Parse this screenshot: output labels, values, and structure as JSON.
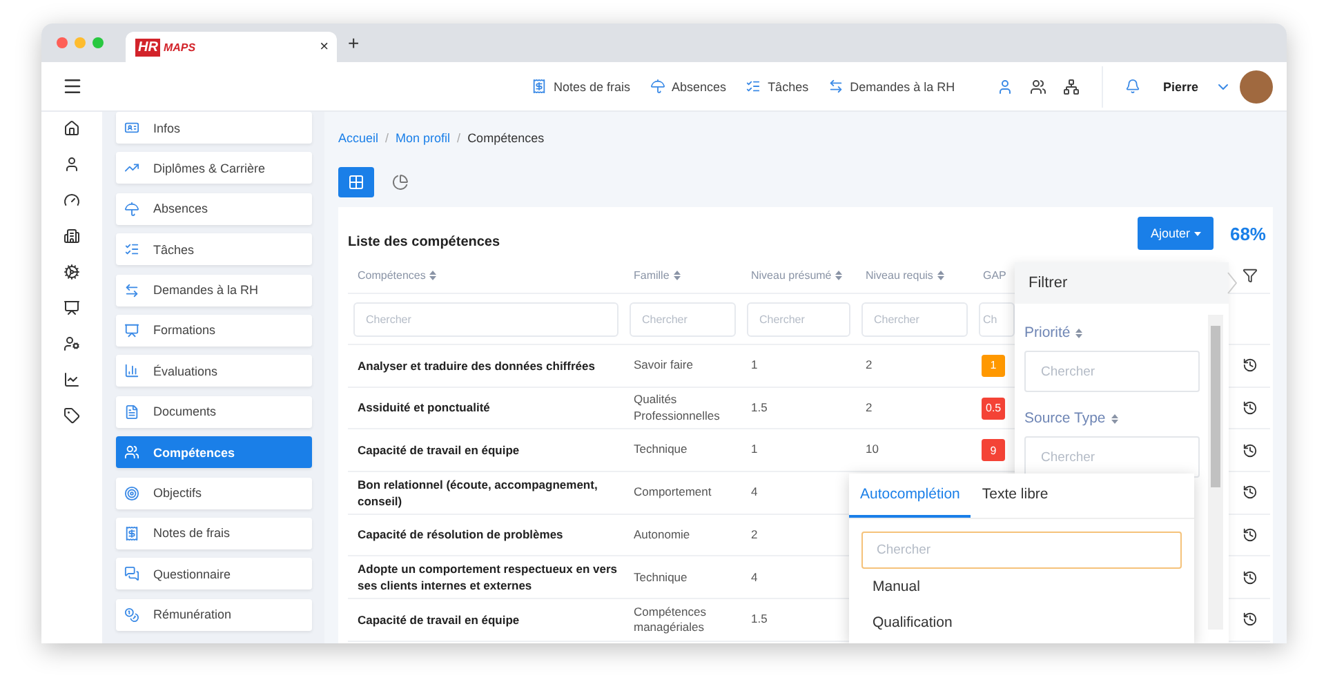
{
  "browser": {
    "tab": {
      "logo_mark": "HR",
      "logo_text": "MAPS",
      "close": "×"
    },
    "new_tab": "+"
  },
  "topbar": {
    "links": [
      {
        "label": "Notes de frais"
      },
      {
        "label": "Absences"
      },
      {
        "label": "Tâches"
      },
      {
        "label": "Demandes à la RH"
      }
    ],
    "user": {
      "name": "Pierre"
    }
  },
  "sidebar": {
    "items": [
      {
        "label": "Infos",
        "selected": false
      },
      {
        "label": "Diplômes & Carrière",
        "selected": false
      },
      {
        "label": "Absences",
        "selected": false
      },
      {
        "label": "Tâches",
        "selected": false
      },
      {
        "label": "Demandes à la RH",
        "selected": false
      },
      {
        "label": "Formations",
        "selected": false
      },
      {
        "label": "Évaluations",
        "selected": false
      },
      {
        "label": "Documents",
        "selected": false
      },
      {
        "label": "Compétences",
        "selected": true
      },
      {
        "label": "Objectifs",
        "selected": false
      },
      {
        "label": "Notes de frais",
        "selected": false
      },
      {
        "label": "Questionnaire",
        "selected": false
      },
      {
        "label": "Rémunération",
        "selected": false
      }
    ]
  },
  "breadcrumb": {
    "separator": "/",
    "items": [
      {
        "label": "Accueil",
        "current": false
      },
      {
        "label": "Mon profil",
        "current": false
      },
      {
        "label": "Compétences",
        "current": true
      }
    ]
  },
  "views": [
    {
      "kind": "table",
      "selected": true
    },
    {
      "kind": "chart",
      "selected": false
    }
  ],
  "card": {
    "title": "Liste des compétences",
    "add_button": "Ajouter",
    "score": "68%"
  },
  "table": {
    "columns": [
      {
        "label": "Compétences",
        "sortable": true,
        "placeholder": "Chercher"
      },
      {
        "label": "Famille",
        "sortable": true,
        "placeholder": "Chercher"
      },
      {
        "label": "Niveau présumé",
        "sortable": true,
        "placeholder": "Chercher"
      },
      {
        "label": "Niveau requis",
        "sortable": true,
        "placeholder": "Chercher"
      },
      {
        "label": "GAP",
        "sortable": false,
        "placeholder": "Ch"
      }
    ],
    "rows": [
      {
        "competence": "Analyser et traduire des données chiffrées",
        "famille": "Savoir faire",
        "presume": "1",
        "requis": "2",
        "gap": {
          "value": "1",
          "color": "#ff9800"
        }
      },
      {
        "competence": "Assiduité et ponctualité",
        "famille": "Qualités Professionnelles",
        "presume": "1.5",
        "requis": "2",
        "gap": {
          "value": "0.5",
          "color": "#f44336"
        }
      },
      {
        "competence": "Capacité de travail en équipe",
        "famille": "Technique",
        "presume": "1",
        "requis": "10",
        "gap": {
          "value": "9",
          "color": "#f44336"
        }
      },
      {
        "competence": "Bon relationnel (écoute, accompagnement, conseil)",
        "famille": "Comportement",
        "presume": "4"
      },
      {
        "competence": "Capacité de résolution de problèmes",
        "famille": "Autonomie",
        "presume": "2"
      },
      {
        "competence": "Adopte un comportement respectueux en vers ses clients internes et externes",
        "famille": "Technique",
        "presume": "4"
      },
      {
        "competence": "Capacité de travail en équipe",
        "famille": "Compétences managériales",
        "presume": "1.5"
      }
    ]
  },
  "filter_panel": {
    "title": "Filtrer",
    "fields": [
      {
        "label": "Priorité",
        "placeholder": "Chercher"
      },
      {
        "label": "Source Type",
        "placeholder": "Chercher"
      }
    ]
  },
  "autocomplete": {
    "tabs": [
      {
        "label": "Autocomplétion",
        "selected": true
      },
      {
        "label": "Texte libre",
        "selected": false
      }
    ],
    "placeholder": "Chercher",
    "options": [
      "Manual",
      "Qualification"
    ]
  }
}
